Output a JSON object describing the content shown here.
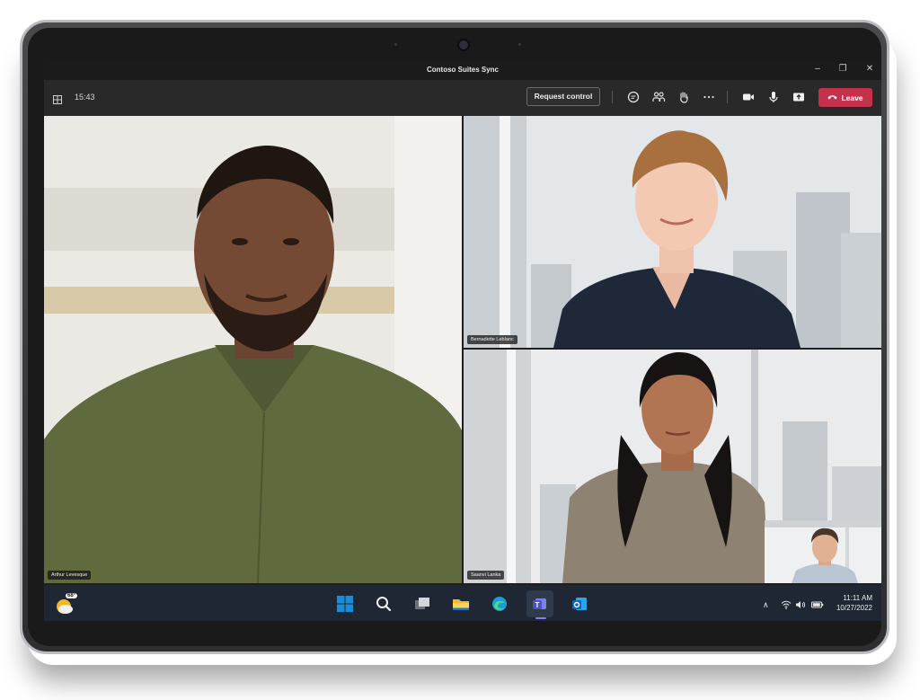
{
  "window": {
    "title": "Contoso Suites Sync"
  },
  "toolbar": {
    "time": "15:43",
    "request_control_label": "Request control",
    "leave_label": "Leave"
  },
  "participants": [
    {
      "name": "Arthur Levesque"
    },
    {
      "name": "Bernadette Leblanc"
    },
    {
      "name": "Saanvi Lanka"
    }
  ],
  "taskbar": {
    "weather_temp": "68°",
    "clock_time": "11:11 AM",
    "clock_date": "10/27/2022"
  },
  "colors": {
    "leave_red": "#c4314b",
    "taskbar_bg": "#1e2733",
    "toolbar_bg": "#292929",
    "windows_blue": "#1a8cd8"
  }
}
